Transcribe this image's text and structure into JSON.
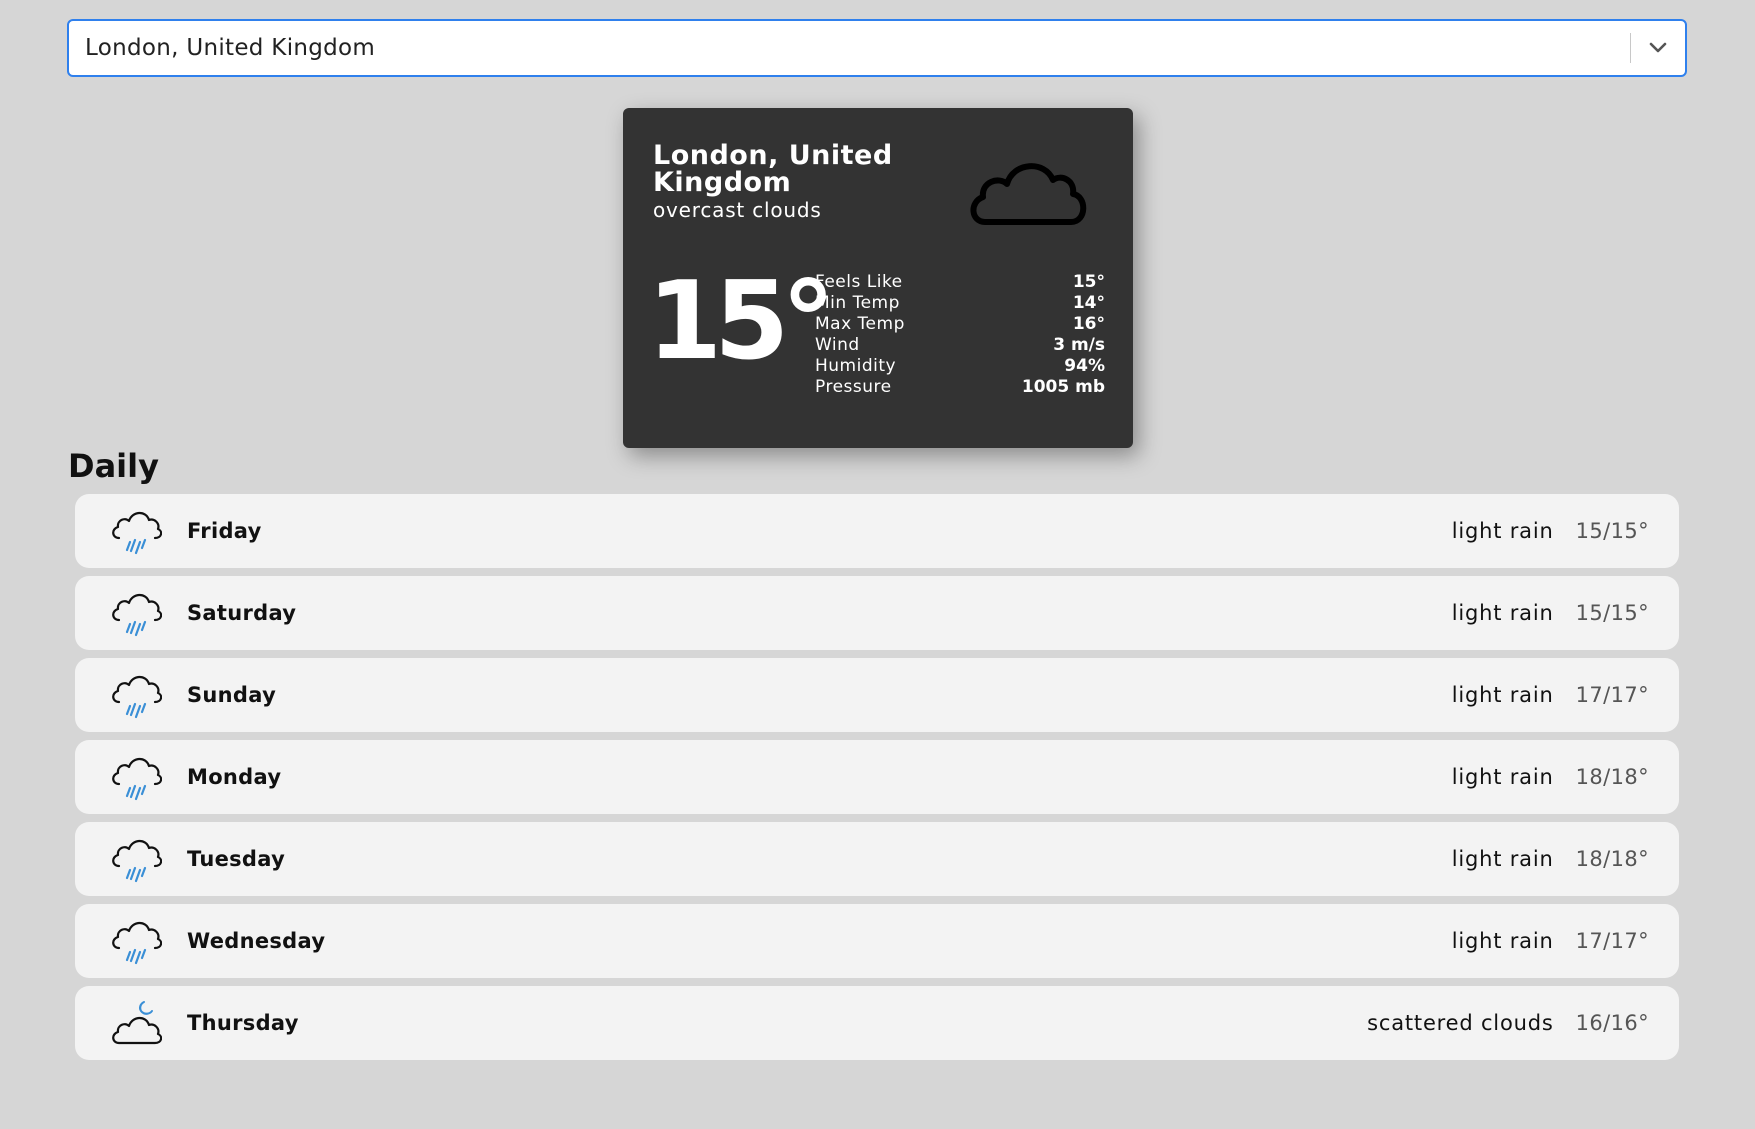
{
  "search": {
    "value": "London, United Kingdom"
  },
  "current": {
    "city": "London, United Kingdom",
    "description": "overcast clouds",
    "icon": "cloud-icon",
    "temperature": "15°",
    "details": [
      {
        "label": "Feels Like",
        "value": "15°"
      },
      {
        "label": "Min Temp",
        "value": "14°"
      },
      {
        "label": "Max Temp",
        "value": "16°"
      },
      {
        "label": "Wind",
        "value": "3 m/s"
      },
      {
        "label": "Humidity",
        "value": "94%"
      },
      {
        "label": "Pressure",
        "value": "1005 mb"
      }
    ]
  },
  "daily": {
    "title": "Daily",
    "days": [
      {
        "name": "Friday",
        "description": "light rain",
        "temp": "15/15°",
        "icon": "rain-cloud-icon"
      },
      {
        "name": "Saturday",
        "description": "light rain",
        "temp": "15/15°",
        "icon": "rain-cloud-icon"
      },
      {
        "name": "Sunday",
        "description": "light rain",
        "temp": "17/17°",
        "icon": "rain-cloud-icon"
      },
      {
        "name": "Monday",
        "description": "light rain",
        "temp": "18/18°",
        "icon": "rain-cloud-icon"
      },
      {
        "name": "Tuesday",
        "description": "light rain",
        "temp": "18/18°",
        "icon": "rain-cloud-icon"
      },
      {
        "name": "Wednesday",
        "description": "light rain",
        "temp": "17/17°",
        "icon": "rain-cloud-icon"
      },
      {
        "name": "Thursday",
        "description": "scattered clouds",
        "temp": "16/16°",
        "icon": "cloud-moon-icon"
      }
    ]
  },
  "colors": {
    "background": "#d6d6d6",
    "card": "#333333",
    "row": "#f3f3f3",
    "accent": "#2f80ed",
    "rain": "#3a8fd6"
  }
}
